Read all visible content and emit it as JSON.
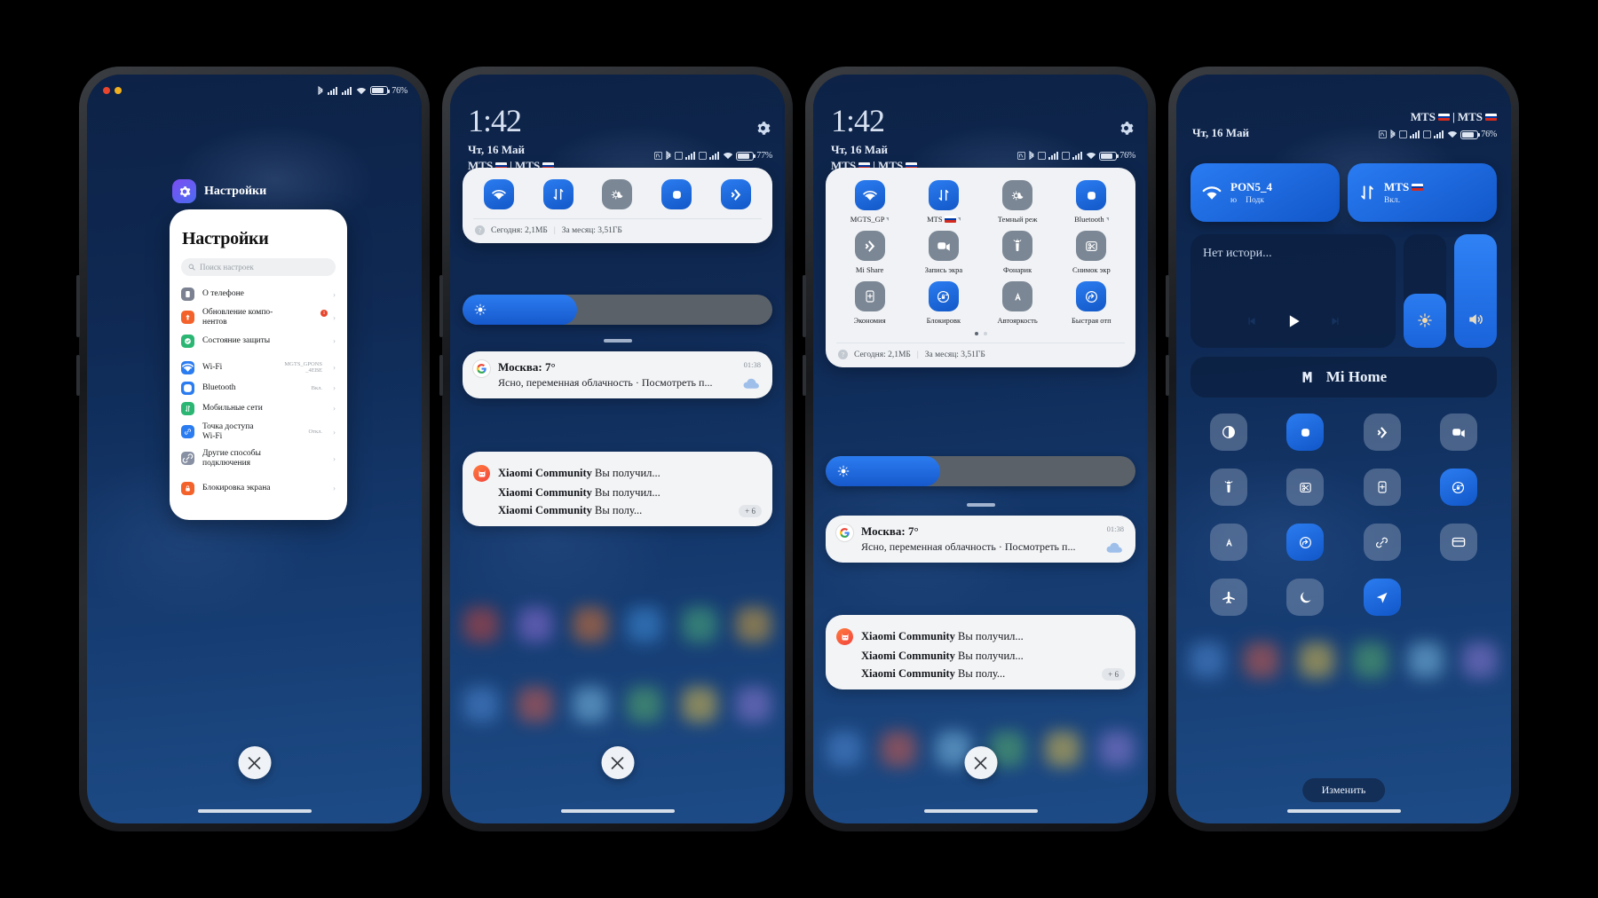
{
  "phone1": {
    "statusbar": {
      "battery_pct": "76%",
      "icons": [
        "bluetooth-icon",
        "signal-icon",
        "signal-icon",
        "wifi-icon",
        "battery-icon"
      ]
    },
    "app_chip": {
      "label": "Настройки",
      "icon": "gear-icon"
    },
    "card": {
      "title": "Настройки",
      "search_placeholder": "Поиск настроек",
      "items": [
        {
          "label": "О телефоне",
          "value": "",
          "icon": "phone-icon",
          "color": "#7b8190",
          "badge": ""
        },
        {
          "label": "Обновление компо-\nнентов",
          "value": "",
          "icon": "update-icon",
          "color": "#f4622c",
          "badge": "1"
        },
        {
          "label": "Состояние защиты",
          "value": "",
          "icon": "shield-icon",
          "color": "#2bb673",
          "badge": ""
        },
        {
          "label": "Wi-Fi",
          "value": "MGTS_GPONS\n_4EBE",
          "icon": "wifi-icon",
          "color": "#2b7cf0",
          "badge": ""
        },
        {
          "label": "Bluetooth",
          "value": "Вкл.",
          "icon": "bluetooth-icon",
          "color": "#2b7cf0",
          "badge": ""
        },
        {
          "label": "Мобильные сети",
          "value": "",
          "icon": "cellular-icon",
          "color": "#2bb673",
          "badge": ""
        },
        {
          "label": "Точка доступа\nWi-Fi",
          "value": "Откл.",
          "icon": "hotspot-icon",
          "color": "#2b7cf0",
          "badge": ""
        },
        {
          "label": "Другие способы\nподключения",
          "value": "",
          "icon": "link-icon",
          "color": "#8890a3",
          "badge": ""
        },
        {
          "label": "Блокировка экрана",
          "value": "",
          "icon": "lock-icon",
          "color": "#f4622c",
          "badge": ""
        }
      ]
    },
    "close_button": "close-icon"
  },
  "phone2": {
    "clock": "1:42",
    "date": "Чт, 16 Май",
    "carrier1": "MTS",
    "carrier2": "MTS",
    "statusbar": {
      "battery_pct": "77%"
    },
    "gear": "gear-icon",
    "quick_tiles": [
      {
        "icon": "wifi-icon",
        "on": true
      },
      {
        "icon": "mobile-data-icon",
        "on": true
      },
      {
        "icon": "dark-mode-icon",
        "on": false
      },
      {
        "icon": "bluetooth-icon",
        "on": true
      },
      {
        "icon": "mi-share-icon",
        "on": true
      }
    ],
    "data_usage": {
      "today_label": "Сегодня: 2,1МБ",
      "month_label": "За месяц: 3,51ГБ"
    },
    "brightness_pct": 37,
    "notifications": [
      {
        "app_icon": "google-icon",
        "title": "Москва: 7°",
        "body": "Ясно, переменная\nоблачность · Посмотреть п...",
        "time": "01:38"
      }
    ],
    "grouped_notification": {
      "app_icon": "xiaomi-community-icon",
      "lines": [
        {
          "app": "Xiaomi Community",
          "text": "Вы получил..."
        },
        {
          "app": "Xiaomi Community",
          "text": "Вы получил..."
        },
        {
          "app": "Xiaomi Community",
          "text": "Вы полу..."
        }
      ],
      "more_badge": "+ 6"
    },
    "close_button": "close-icon"
  },
  "phone3": {
    "clock": "1:42",
    "date": "Чт, 16 Май",
    "carrier1": "MTS",
    "carrier2": "MTS",
    "statusbar": {
      "battery_pct": "76%"
    },
    "gear": "gear-icon",
    "tiles": [
      {
        "label": "MGTS_GP",
        "icon": "wifi-icon",
        "on": true,
        "caret": true
      },
      {
        "label": "MTS",
        "icon": "mobile-data-icon",
        "on": true,
        "caret": true,
        "flag": true
      },
      {
        "label": "Темный реж",
        "icon": "dark-mode-icon",
        "on": false,
        "caret": false
      },
      {
        "label": "Bluetooth",
        "icon": "bluetooth-icon",
        "on": true,
        "caret": true
      },
      {
        "label": "Mi Share",
        "icon": "mi-share-icon",
        "on": false,
        "caret": false
      },
      {
        "label": "Запись экра",
        "icon": "screen-record-icon",
        "on": false,
        "caret": false
      },
      {
        "label": "Фонарик",
        "icon": "flashlight-icon",
        "on": false,
        "caret": false
      },
      {
        "label": "Снимок экр",
        "icon": "screenshot-icon",
        "on": false,
        "caret": false
      },
      {
        "label": "Экономия",
        "icon": "battery-saver-icon",
        "on": false,
        "caret": false
      },
      {
        "label": "Блокировк",
        "icon": "rotation-lock-icon",
        "on": true,
        "caret": false
      },
      {
        "label": "Автояркость",
        "icon": "auto-brightness-icon",
        "on": false,
        "caret": false
      },
      {
        "label": "Быстрая отп",
        "icon": "quick-reply-icon",
        "on": true,
        "caret": false
      }
    ],
    "page_dots": {
      "count": 2,
      "active": 0
    },
    "data_usage": {
      "today_label": "Сегодня: 2,1МБ",
      "month_label": "За месяц: 3,51ГБ"
    },
    "brightness_pct": 37,
    "notifications": [
      {
        "app_icon": "google-icon",
        "title": "Москва: 7°",
        "body": "Ясно, переменная\nоблачность · Посмотреть п...",
        "time": "01:38"
      }
    ],
    "grouped_notification": {
      "app_icon": "xiaomi-community-icon",
      "lines": [
        {
          "app": "Xiaomi Community",
          "text": "Вы получил..."
        },
        {
          "app": "Xiaomi Community",
          "text": "Вы получил..."
        },
        {
          "app": "Xiaomi Community",
          "text": "Вы полу..."
        }
      ],
      "more_badge": "+ 6"
    },
    "close_button": "close-icon"
  },
  "phone4": {
    "date": "Чт, 16 Май",
    "carrier1": "MTS",
    "carrier2": "MTS",
    "statusbar": {
      "battery_pct": "76%"
    },
    "connectivity": [
      {
        "icon": "wifi-icon",
        "title": "PON5_4",
        "sub1": "ю",
        "sub2": "Подк",
        "on": true
      },
      {
        "icon": "mobile-data-icon",
        "title": "MTS",
        "sub1": "Вкл.",
        "sub2": "",
        "on": true,
        "flag": true
      }
    ],
    "media": {
      "title": "Нет истори...",
      "prev": "prev-icon",
      "play": "play-icon",
      "next": "next-icon"
    },
    "sliders": [
      {
        "name": "brightness-slider",
        "icon": "brightness-icon",
        "pct": 48
      },
      {
        "name": "volume-slider",
        "icon": "volume-icon",
        "pct": 100
      }
    ],
    "mi_home": {
      "label": "Mi Home",
      "icon": "mi-home-icon"
    },
    "tiles": [
      {
        "icon": "contrast-icon",
        "on": false
      },
      {
        "icon": "bluetooth-icon",
        "on": true
      },
      {
        "icon": "mi-share-icon",
        "on": false
      },
      {
        "icon": "screen-record-icon",
        "on": false
      },
      {
        "icon": "flashlight-icon",
        "on": false
      },
      {
        "icon": "screenshot-icon",
        "on": false
      },
      {
        "icon": "battery-saver-icon",
        "on": false
      },
      {
        "icon": "rotation-lock-icon",
        "on": true
      },
      {
        "icon": "auto-brightness-icon",
        "on": false
      },
      {
        "icon": "quick-reply-icon",
        "on": true
      },
      {
        "icon": "link-icon",
        "on": false
      },
      {
        "icon": "wallet-icon",
        "on": false
      },
      {
        "icon": "airplane-icon",
        "on": false
      },
      {
        "icon": "moon-icon",
        "on": false
      },
      {
        "icon": "location-icon",
        "on": true
      }
    ],
    "edit_label": "Изменить"
  },
  "colors": {
    "accent": "#2b7cf0",
    "tile_off": "#7b8795",
    "card_bg": "#f0f2f5",
    "wall_top": "#0d2246",
    "wall_bottom": "#1d4b86"
  }
}
